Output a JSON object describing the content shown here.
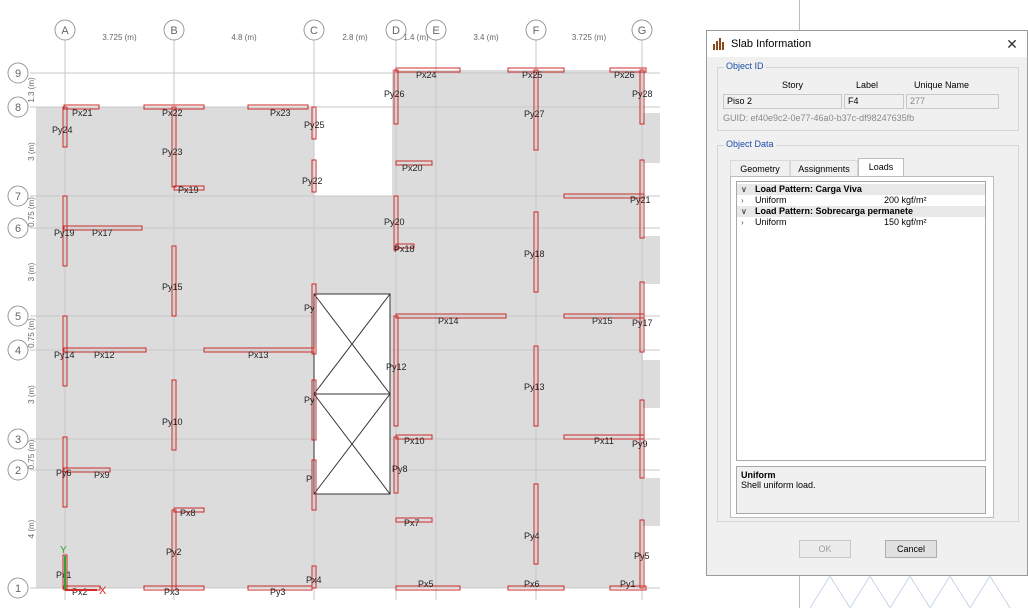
{
  "plan": {
    "grid_columns": [
      {
        "label": "A"
      },
      {
        "label": "B"
      },
      {
        "label": "C"
      },
      {
        "label": "D"
      },
      {
        "label": "E"
      },
      {
        "label": "F"
      },
      {
        "label": "G"
      }
    ],
    "column_dims": [
      "3.725 (m)",
      "4.8 (m)",
      "2.8 (m)",
      "1.4 (m)",
      "3.4 (m)",
      "3.725 (m)"
    ],
    "grid_rows": [
      {
        "label": "9"
      },
      {
        "label": "8"
      },
      {
        "label": "7"
      },
      {
        "label": "6"
      },
      {
        "label": "5"
      },
      {
        "label": "4"
      },
      {
        "label": "3"
      },
      {
        "label": "2"
      },
      {
        "label": "1"
      }
    ],
    "row_dims": [
      "1.3 (m)",
      "3 (m)",
      "0.75 (m)",
      "3 (m)",
      "0.75 (m)",
      "3 (m)",
      "0.75 (m)",
      "4 (m)"
    ],
    "element_labels": [
      "Px21",
      "Px22",
      "Px23",
      "Py25",
      "Py24",
      "Py23",
      "Px19",
      "Py22",
      "Px24",
      "Px25",
      "Px26",
      "Py26",
      "Py27",
      "Py28",
      "Px20",
      "Py20",
      "Px18",
      "Py21",
      "Py18",
      "Py19",
      "Px17",
      "Py15",
      "Px14",
      "Px15",
      "Py17",
      "Py14",
      "Px12",
      "Px13",
      "Py12",
      "Py13",
      "Py10",
      "Px10",
      "Px11",
      "Py9",
      "Py6",
      "Px9",
      "Py8",
      "Px8",
      "Px7",
      "Py4",
      "Py2",
      "Py5",
      "Px1",
      "Px2",
      "Px3",
      "Py3",
      "Px4",
      "Px5",
      "Px6",
      "Py1",
      "Py",
      "Py",
      "P"
    ],
    "axis_y": "Y",
    "axis_x": "X"
  },
  "dialog": {
    "title": "Slab Information",
    "object_id": {
      "group_title": "Object ID",
      "headers": [
        "Story",
        "Label",
        "Unique Name"
      ],
      "story": "Piso 2",
      "label": "F4",
      "unique_name": "277",
      "guid": "GUID:  ef40e9c2-0e77-46a0-b37c-df98247635fb"
    },
    "object_data": {
      "group_title": "Object Data",
      "tabs": [
        "Geometry",
        "Assignments",
        "Loads"
      ],
      "active_tab": "Loads",
      "tree": [
        {
          "type": "header",
          "chevron": "∨",
          "text": "Load Pattern: Carga Viva",
          "value": ""
        },
        {
          "type": "item",
          "chevron": "›",
          "text": "Uniform",
          "value": "200 kgf/m²"
        },
        {
          "type": "header",
          "chevron": "∨",
          "text": "Load Pattern: Sobrecarga permanete",
          "value": ""
        },
        {
          "type": "item",
          "chevron": "›",
          "text": "Uniform",
          "value": "150 kgf/m²"
        }
      ],
      "description_title": "Uniform",
      "description_text": "Shell uniform load."
    },
    "buttons": {
      "ok": "OK",
      "cancel": "Cancel"
    }
  },
  "colors": {
    "slab_fill": "#dcdcdc",
    "wall_red": "#cc2a2a",
    "grid_line": "#c8c8c8",
    "group_title": "#1e4fa8",
    "axis_green": "#2ea32e",
    "axis_red": "#d92a2a"
  }
}
